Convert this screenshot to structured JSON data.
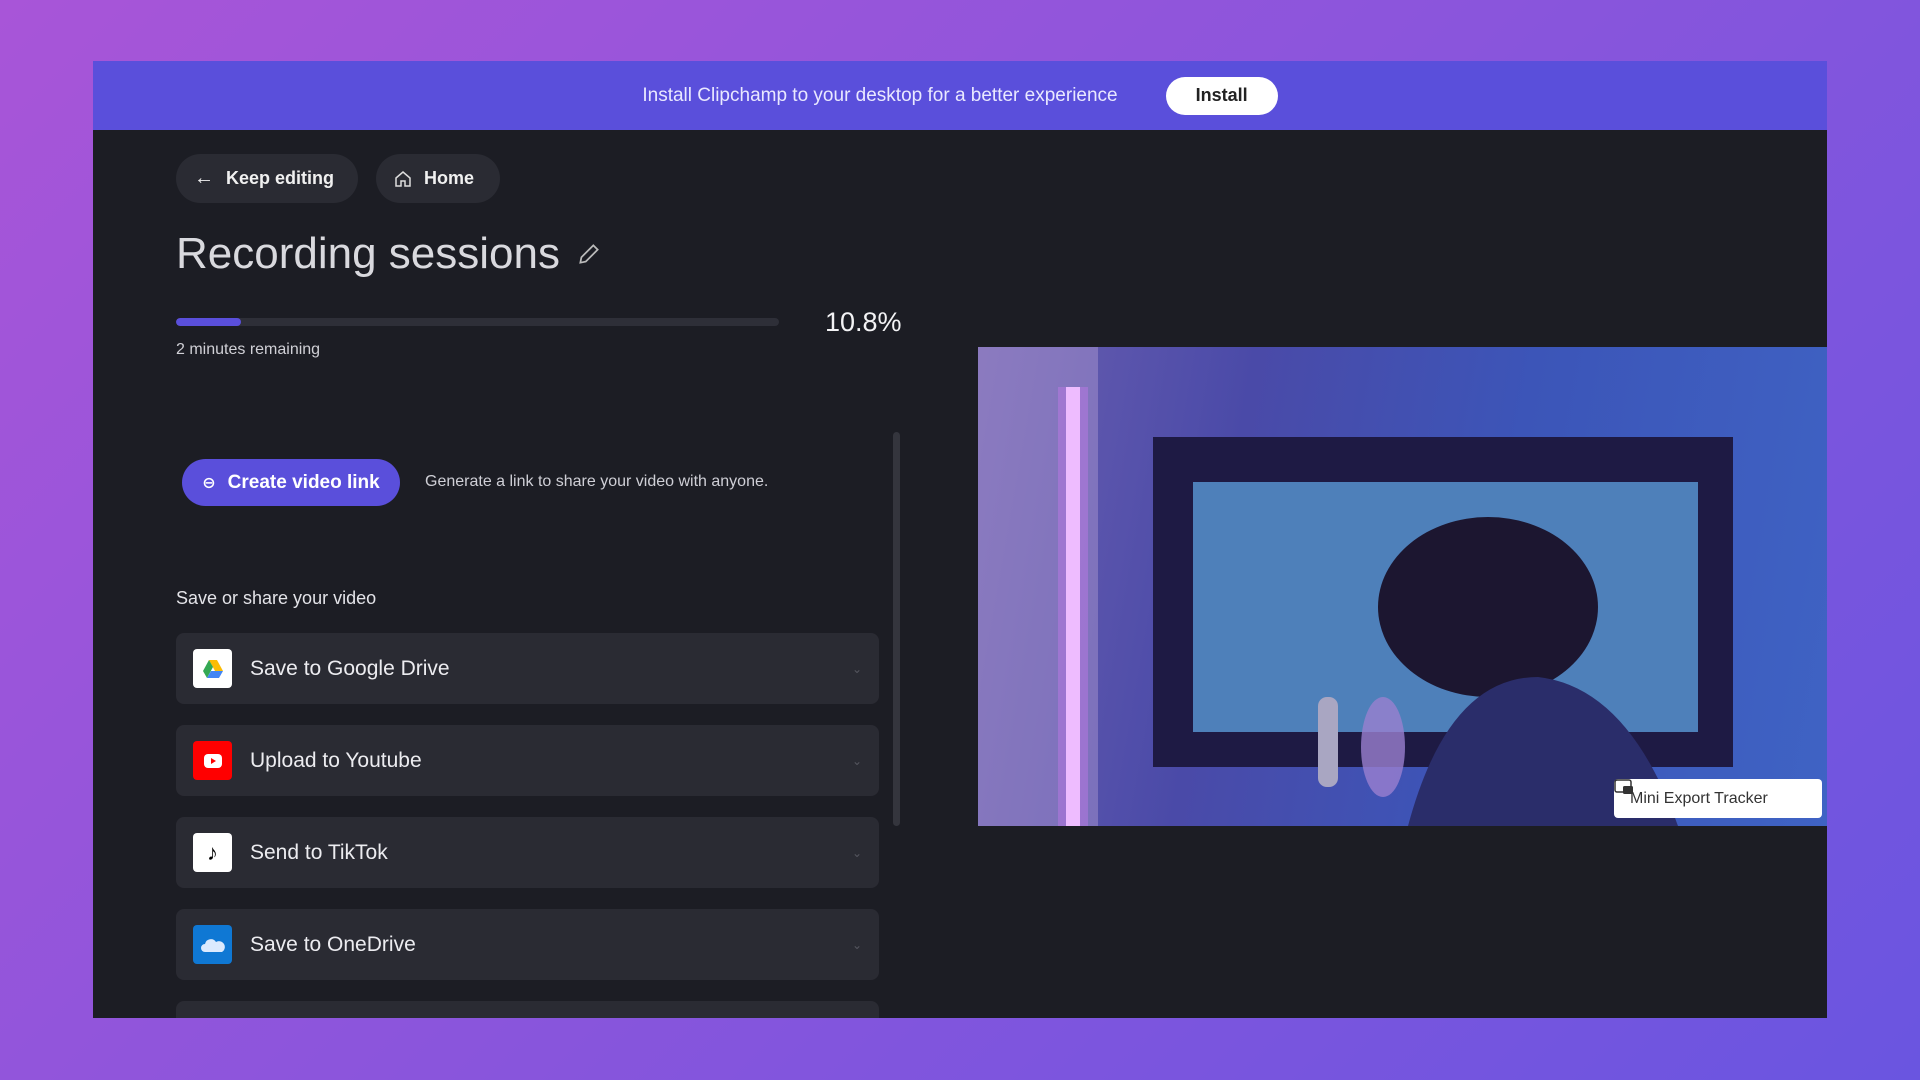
{
  "banner": {
    "text": "Install Clipchamp to your desktop for a better experience",
    "install_label": "Install"
  },
  "nav": {
    "keep_editing": "Keep editing",
    "home": "Home"
  },
  "project": {
    "title": "Recording sessions"
  },
  "progress": {
    "percent": 10.8,
    "percent_label": "10.8%",
    "remaining": "2 minutes remaining"
  },
  "link": {
    "button_label": "Create video link",
    "description": "Generate a link to share your video with anyone."
  },
  "share": {
    "heading": "Save or share your video",
    "items": [
      {
        "label": "Save to Google Drive",
        "icon": "google-drive-icon"
      },
      {
        "label": "Upload to Youtube",
        "icon": "youtube-icon"
      },
      {
        "label": "Send to TikTok",
        "icon": "tiktok-icon"
      },
      {
        "label": "Save to OneDrive",
        "icon": "onedrive-icon"
      }
    ]
  },
  "preview": {
    "tracker_label": "Mini Export Tracker"
  },
  "colors": {
    "accent": "#5a4fdb",
    "panel": "#1c1d24",
    "card": "#2a2b33"
  }
}
